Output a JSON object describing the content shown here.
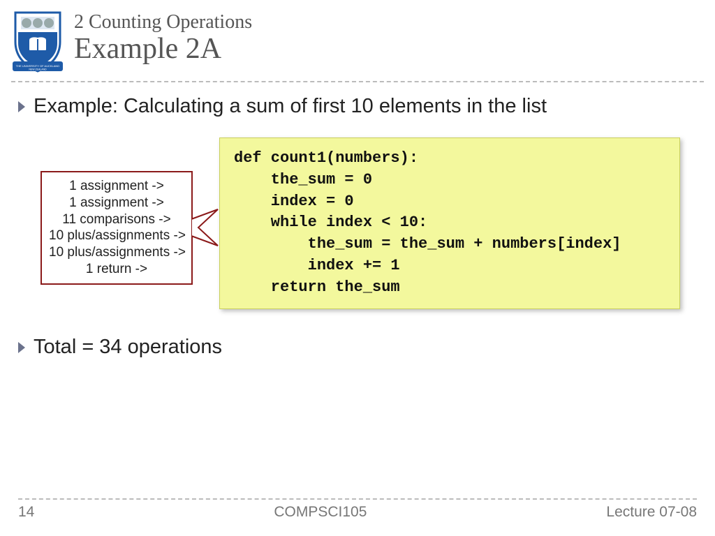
{
  "header": {
    "subtitle": "2 Counting Operations",
    "title": "Example 2A"
  },
  "bullets": {
    "line1": "Example: Calculating a sum of first 10 elements in the list",
    "line2": "Total = 34 operations"
  },
  "callout": {
    "l1": "1 assignment ->",
    "l2": "1 assignment ->",
    "l3": "11 comparisons ->",
    "l4": "10 plus/assignments ->",
    "l5": "10 plus/assignments ->",
    "l6": "1 return ->"
  },
  "code": "def count1(numbers):\n    the_sum = 0\n    index = 0\n    while index < 10:\n        the_sum = the_sum + numbers[index]\n        index += 1\n    return the_sum",
  "footer": {
    "page": "14",
    "course": "COMPSCI105",
    "lecture": "Lecture 07-08"
  }
}
